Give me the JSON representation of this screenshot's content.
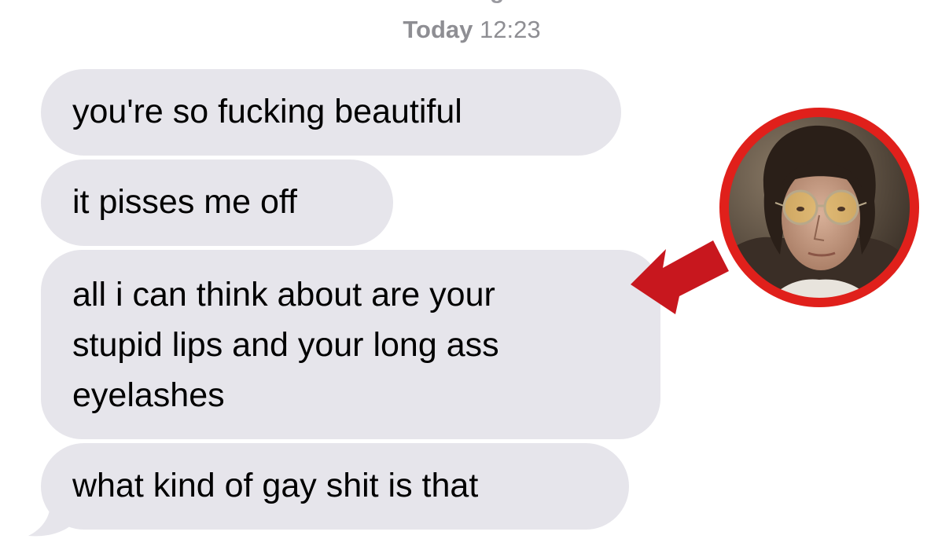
{
  "header": {
    "service": "iMessage",
    "time_prefix": "Today",
    "time": "12:23"
  },
  "messages": [
    {
      "lines": [
        "you're so fucking beautiful"
      ]
    },
    {
      "lines": [
        "it pisses me off"
      ]
    },
    {
      "lines": [
        "all i can think about are your",
        "stupid lips and your long ass",
        "eyelashes"
      ]
    },
    {
      "lines": [
        "what kind of gay shit is that"
      ]
    }
  ],
  "annotation": {
    "arrow_color": "#c8171e",
    "ring_color": "#e0201b",
    "arrow_icon": "red-arrow-icon",
    "photo_icon": "portrait-photo-icon"
  },
  "colors": {
    "bubble": "#e6e5eb",
    "timestamp": "#8e8e93"
  }
}
